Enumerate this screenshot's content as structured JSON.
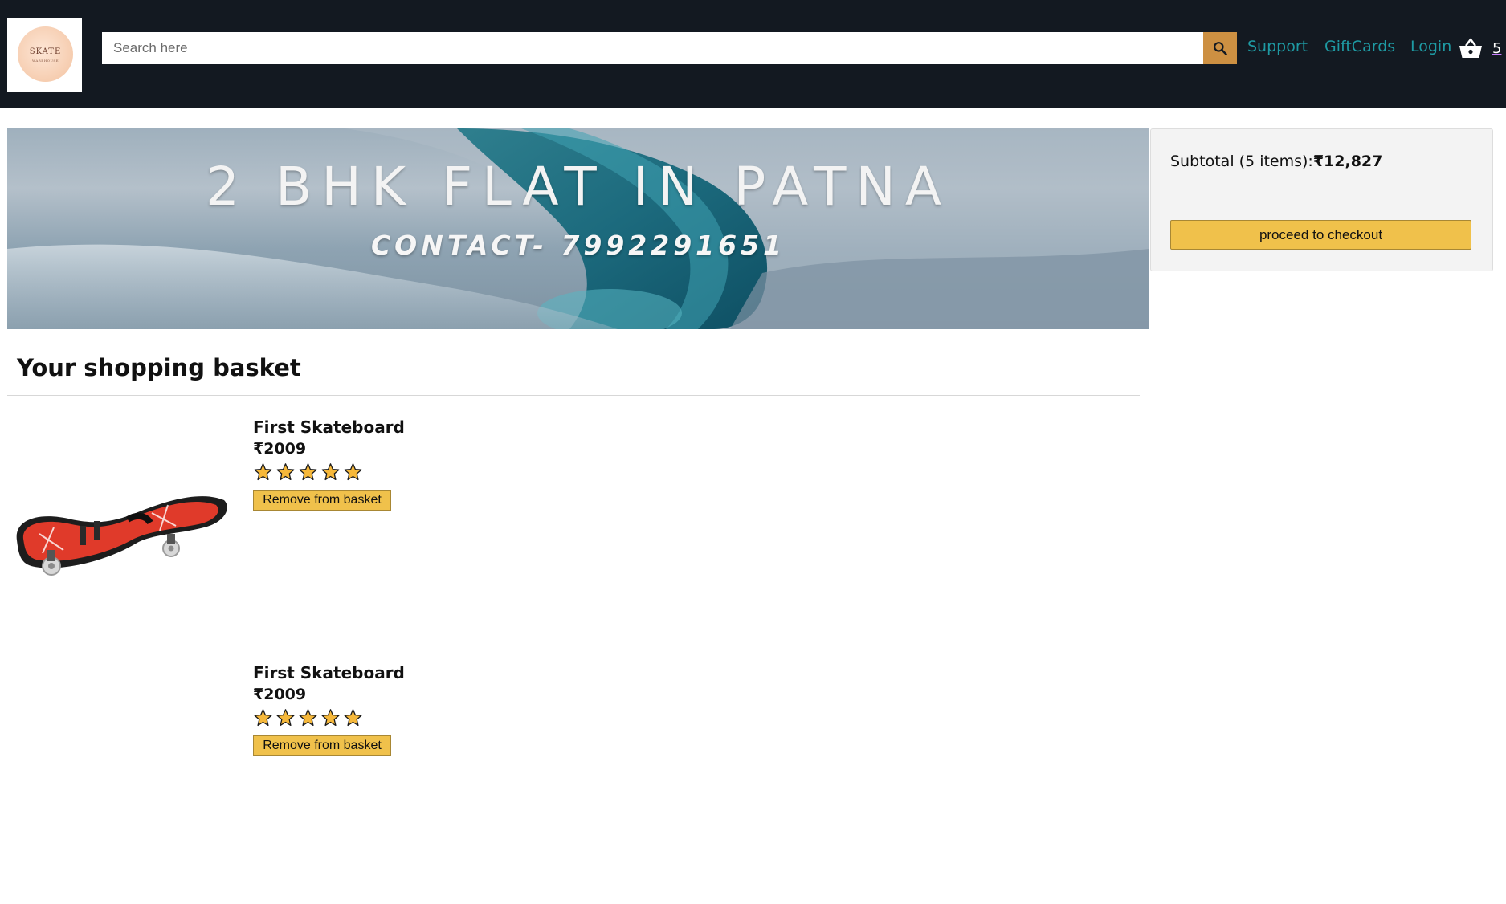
{
  "header": {
    "logo": {
      "text": "SKATE",
      "subtext": "WAREHOUSE"
    },
    "search": {
      "placeholder": "Search here",
      "value": ""
    },
    "nav": {
      "support": "Support",
      "giftcards": "GiftCards",
      "login": "Login"
    },
    "basket_count": "5",
    "icons": {
      "search": "search-icon",
      "basket": "basket-icon"
    },
    "colors": {
      "background": "#131921",
      "search_button": "#cd9042",
      "link": "#1e9aa3"
    }
  },
  "banner": {
    "title": "2 BHK FLAT IN PATNA",
    "contact": "CONTACT- 7992291651"
  },
  "subtotal": {
    "label": "Subtotal (5 items):",
    "amount": "₹12,827",
    "checkout_label": "proceed to checkout"
  },
  "basket": {
    "heading": "Your shopping basket",
    "items": [
      {
        "title": "First Skateboard",
        "price": "₹2009",
        "rating": 5,
        "remove_label": "Remove from basket"
      },
      {
        "title": "First Skateboard",
        "price": "₹2009",
        "rating": 5,
        "remove_label": "Remove from basket"
      }
    ]
  },
  "colors": {
    "button": "#f0c14b",
    "button_border": "#a88734",
    "panel": "#f3f3f3"
  }
}
